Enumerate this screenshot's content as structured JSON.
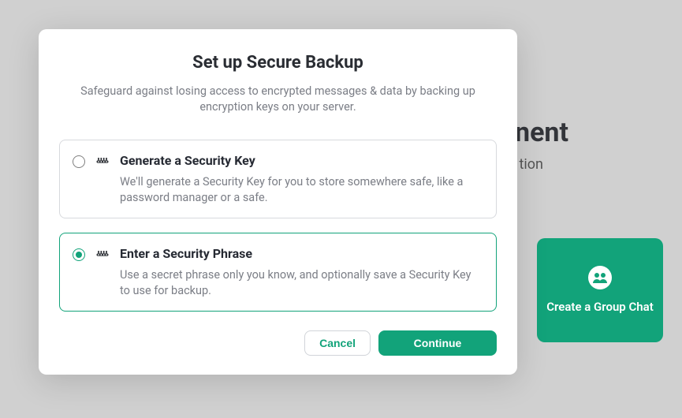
{
  "background": {
    "heading_fragment": "nent",
    "subheading_fragment": "tion",
    "group_chat_label": "Create a Group Chat"
  },
  "modal": {
    "title": "Set up Secure Backup",
    "description": "Safeguard against losing access to encrypted messages & data by backing up encryption keys on your server.",
    "options": [
      {
        "id": "generate-key",
        "title": "Generate a Security Key",
        "description": "We'll generate a Security Key for you to store somewhere safe, like a password manager or a safe.",
        "selected": false
      },
      {
        "id": "enter-phrase",
        "title": "Enter a Security Phrase",
        "description": "Use a secret phrase only you know, and optionally save a Security Key to use for backup.",
        "selected": true
      }
    ],
    "actions": {
      "cancel": "Cancel",
      "continue": "Continue"
    }
  },
  "colors": {
    "accent": "#12a37a",
    "muted_text": "#7b7e86",
    "heading": "#262a33"
  }
}
